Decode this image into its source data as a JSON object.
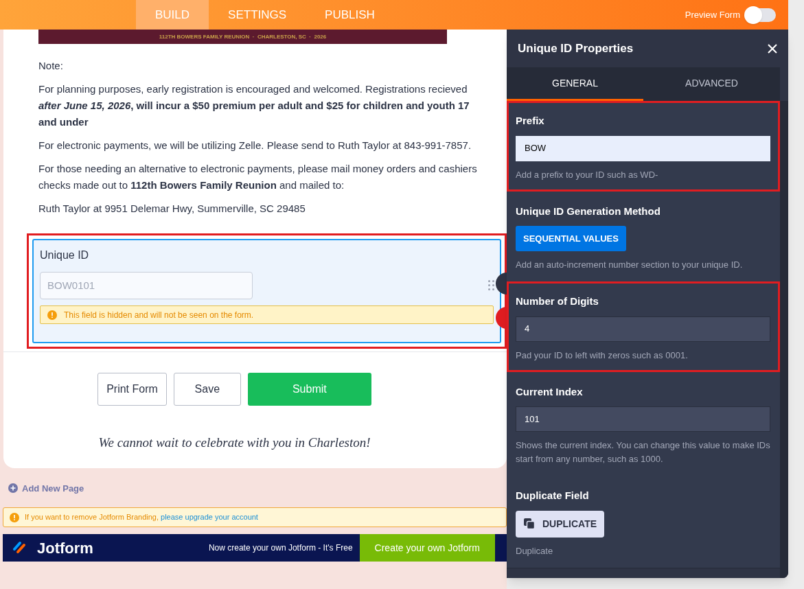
{
  "topbar": {
    "tabs": [
      {
        "label": "BUILD",
        "selected": true
      },
      {
        "label": "SETTINGS",
        "selected": false
      },
      {
        "label": "PUBLISH",
        "selected": false
      }
    ],
    "preview": {
      "label": "Preview Form",
      "on": false
    }
  },
  "form": {
    "banner_text": "112TH BOWERS FAMILY REUNION  ·  CHARLESTON, SC  ·  2026",
    "paragraphs": [
      "Note:",
      "For planning purposes, early registration is encouraged and welcomed.  Registrations recieved ***after June 15, 2026*, will incur a $50 premium per adult and $25 for children and youth 17 and under**",
      "For electronic payments, we will be utilizing Zelle. Please send to Ruth Taylor at 843-991-7857.",
      "For those needing an alternative to electronic payments, please mail money orders and cashiers checks made out to **112th Bowers Family Reunion** and mailed to:",
      "Ruth Taylor at 9951 Delemar Hwy, Summerville, SC  29485"
    ],
    "unique_id_field": {
      "label": "Unique ID",
      "placeholder": "BOW0101",
      "warning": "This field is hidden and will not be seen on the form.",
      "highlighted": true
    },
    "buttons": [
      {
        "label": "Print Form",
        "kind": "plain"
      },
      {
        "label": "Save",
        "kind": "plain"
      },
      {
        "label": "Submit",
        "kind": "primary"
      }
    ],
    "closing": "We cannot wait to celebrate with you in Charleston!"
  },
  "add_page": "Add New Page",
  "branding_notice": {
    "text": "If you want to remove Jotform Branding,",
    "link": "please upgrade your account"
  },
  "footer_banner": {
    "logo": "Jotform",
    "text": "Now create your own Jotform - It's Free",
    "button": "Create your own Jotform"
  },
  "panel": {
    "title": "Unique ID Properties",
    "tabs": [
      {
        "label": "GENERAL",
        "selected": true
      },
      {
        "label": "ADVANCED",
        "selected": false
      }
    ],
    "sections": [
      {
        "kind": "input",
        "label": "Prefix",
        "value": "BOW",
        "focused": true,
        "hint": "Add a prefix to your ID such as WD-",
        "highlighted": true
      },
      {
        "kind": "choice",
        "label": "Unique ID Generation Method",
        "button": "SEQUENTIAL VALUES",
        "hint": "Add an auto-increment number section to your unique ID.",
        "highlighted": false
      },
      {
        "kind": "input",
        "label": "Number of Digits",
        "value": "4",
        "focused": false,
        "hint": "Pad your ID to left with zeros such as 0001.",
        "highlighted": true
      },
      {
        "kind": "input",
        "label": "Current Index",
        "value": "101",
        "focused": false,
        "hint": "Shows the current index. You can change this value to make IDs start from any number, such as 1000.",
        "highlighted": false
      },
      {
        "kind": "action",
        "label": "Duplicate Field",
        "button": "DUPLICATE",
        "hint": "Duplicate",
        "highlighted": false
      }
    ]
  }
}
